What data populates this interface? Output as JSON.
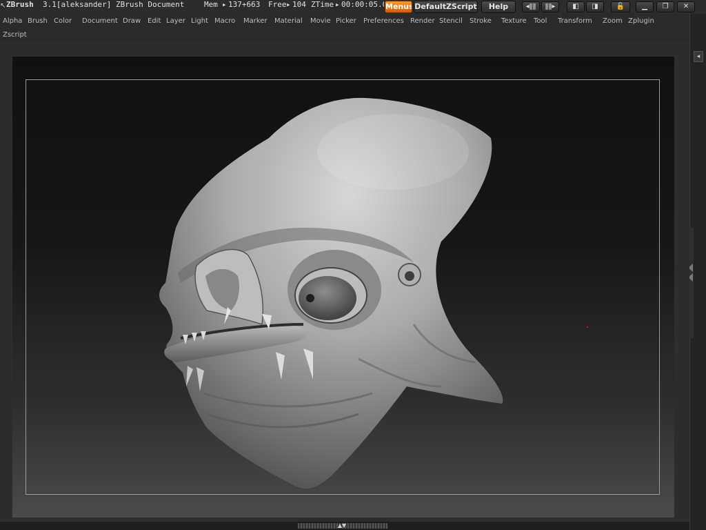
{
  "titlebar": {
    "app": "ZBrush",
    "version_user": "3.1[aleksander]",
    "document": "ZBrush Document",
    "mem_label": "Mem",
    "mem_value": "137+663",
    "free_label": "Free",
    "free_value": "104",
    "ztime_label": "ZTime",
    "ztime_value": "00:00:05.0",
    "menus_button": "Menus",
    "script_button": "DefaultZScript",
    "help_button": "Help"
  },
  "menu": {
    "items": [
      "Alpha",
      "Brush",
      "Color",
      "Document",
      "Draw",
      "Edit",
      "Layer",
      "Light",
      "Macro",
      "Marker",
      "Material",
      "Movie",
      "Picker",
      "Preferences",
      "Render",
      "Stencil",
      "Stroke",
      "Texture",
      "Tool",
      "Transform",
      "Zoom",
      "Zplugin"
    ],
    "second_row": [
      "Zscript"
    ]
  },
  "colors": {
    "accent": "#e8700f",
    "background": "#2a2a2a",
    "canvas_top": "#111111",
    "canvas_bottom": "#4a4a4a",
    "model": "#a8a8a8"
  },
  "canvas": {
    "content": "sculpted alien head model (gray clay)"
  }
}
